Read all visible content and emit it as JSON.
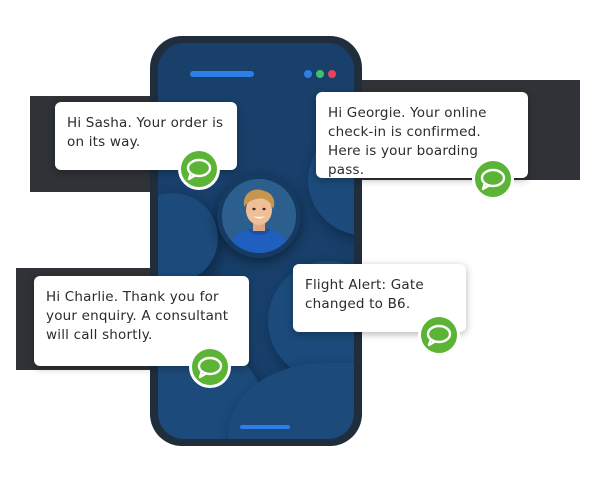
{
  "colors": {
    "background": "#ffffff",
    "phone_frame": "#1f2d3d",
    "screen": "#18406b",
    "accent_blue": "#2d7ee8",
    "chat_green": "#5bb436",
    "dot_blue": "#2d7ee8",
    "dot_green": "#3fc06b",
    "dot_red": "#e8435b"
  },
  "messages": [
    {
      "text": "Hi Sasha. Your order is on its way.",
      "icon": "chat-bubble-icon"
    },
    {
      "text": "Hi Georgie. Your online check-in is confirmed. Here is your boarding pass.",
      "icon": "chat-bubble-icon"
    },
    {
      "text": "Flight Alert: Gate changed to B6.",
      "icon": "chat-bubble-icon"
    },
    {
      "text": "Hi Charlie. Thank you for your enquiry. A consultant will call shortly.",
      "icon": "chat-bubble-icon"
    }
  ],
  "avatar": {
    "icon": "person-avatar"
  }
}
